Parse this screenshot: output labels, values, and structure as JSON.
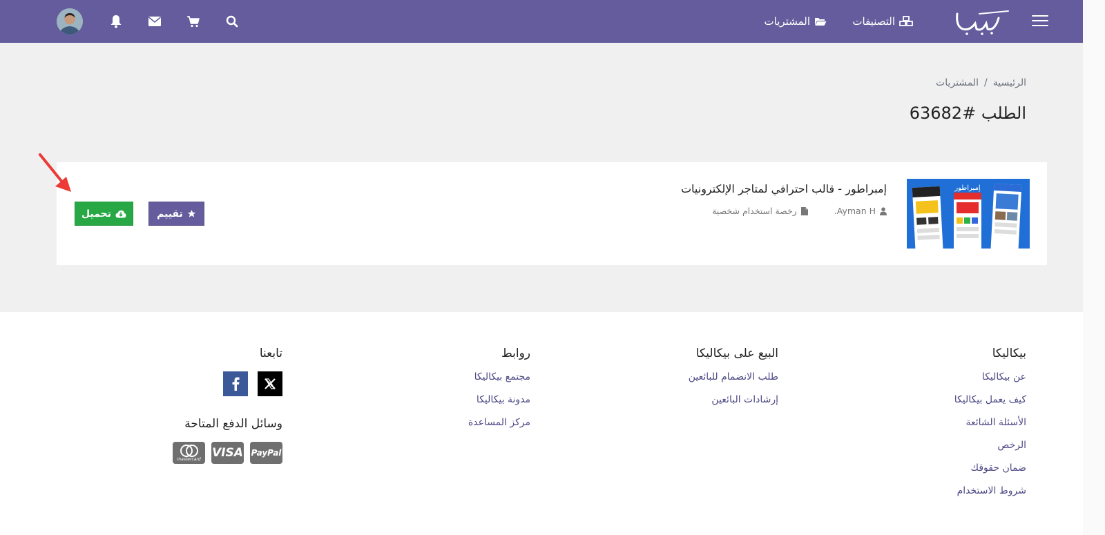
{
  "header": {
    "nav_categories": "التصنيفات",
    "nav_purchases": "المشتريات",
    "accent_color": "#645c9c"
  },
  "breadcrumb": {
    "home": "الرئيسية",
    "separator": "/",
    "current": "المشتريات"
  },
  "page": {
    "title": "الطلب #63682"
  },
  "order_item": {
    "title": "إمبراطور - قالب احترافي لمتاجر الإلكترونيات",
    "author": "Ayman H.",
    "license": "رخصة استخدام شخصية",
    "thumb_caption": "إمبراطور",
    "rate_label": "تقييم",
    "download_label": "تحميل",
    "download_color": "#28a745"
  },
  "footer": {
    "col1": {
      "title": "بيكاليكا",
      "links": [
        "عن بيكاليكا",
        "كيف يعمل بيكاليكا",
        "الأسئلة الشائعة",
        "الرخص",
        "ضمان حقوقك",
        "شروط الاستخدام"
      ]
    },
    "col2": {
      "title": "البيع على بيكاليكا",
      "links": [
        "طلب الانضمام للبائعين",
        "إرشادات البائعين"
      ]
    },
    "col3": {
      "title": "روابط",
      "links": [
        "مجتمع بيكاليكا",
        "مدونة بيكاليكا",
        "مركز المساعدة"
      ]
    },
    "col4": {
      "title": "تابعنا",
      "payment_title": "وسائل الدفع المتاحة",
      "payments": [
        "PayPal",
        "VISA",
        "mastercard"
      ]
    }
  }
}
